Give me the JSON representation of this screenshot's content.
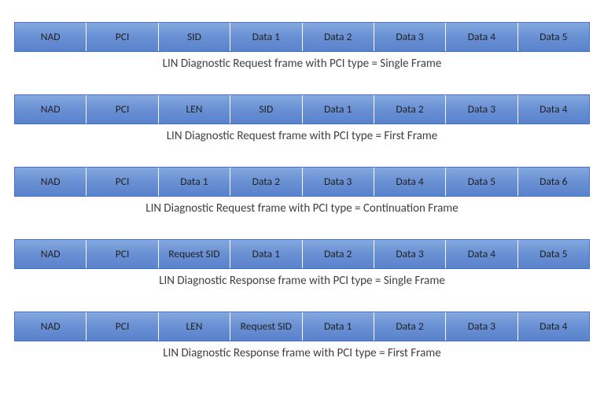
{
  "frames": [
    {
      "cells": [
        "NAD",
        "PCI",
        "SID",
        "Data 1",
        "Data 2",
        "Data 3",
        "Data 4",
        "Data 5"
      ],
      "caption": "LIN Diagnostic Request frame with PCI type = Single Frame"
    },
    {
      "cells": [
        "NAD",
        "PCI",
        "LEN",
        "SID",
        "Data 1",
        "Data 2",
        "Data 3",
        "Data 4"
      ],
      "caption": "LIN Diagnostic Request frame with PCI type = First Frame"
    },
    {
      "cells": [
        "NAD",
        "PCI",
        "Data 1",
        "Data 2",
        "Data 3",
        "Data 4",
        "Data 5",
        "Data 6"
      ],
      "caption": "LIN Diagnostic Request frame with PCI type = Continuation Frame"
    },
    {
      "cells": [
        "NAD",
        "PCI",
        "Request SID",
        "Data 1",
        "Data 2",
        "Data 3",
        "Data 4",
        "Data 5"
      ],
      "caption": "LIN Diagnostic Response frame with PCI type = Single Frame"
    },
    {
      "cells": [
        "NAD",
        "PCI",
        "LEN",
        "Request SID",
        "Data 1",
        "Data 2",
        "Data 3",
        "Data 4"
      ],
      "caption": "LIN Diagnostic Response frame with PCI type = First Frame"
    }
  ]
}
